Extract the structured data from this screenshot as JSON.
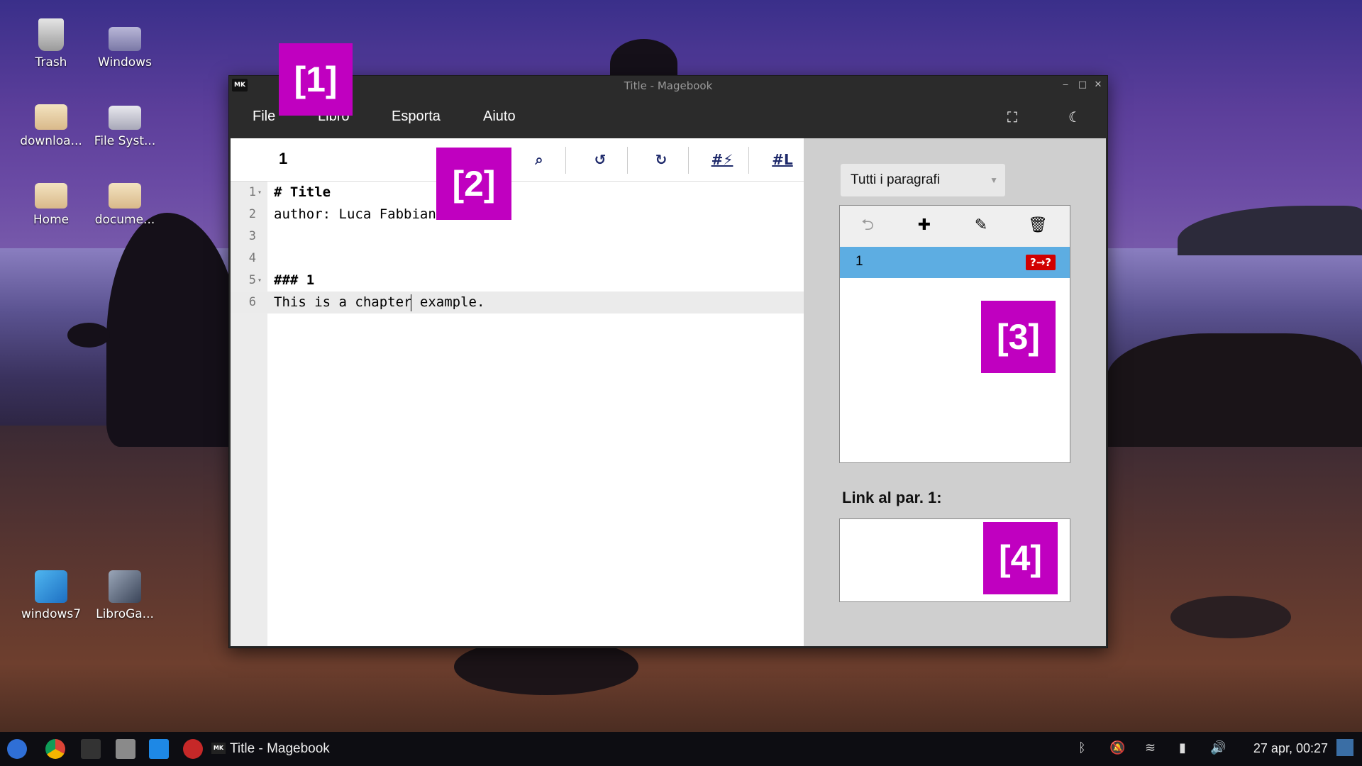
{
  "desktop": {
    "icons": [
      {
        "label": "Trash"
      },
      {
        "label": "Windows"
      },
      {
        "label": "downloa..."
      },
      {
        "label": "File Syst..."
      },
      {
        "label": "Home"
      },
      {
        "label": "docume..."
      },
      {
        "label": "windows7"
      },
      {
        "label": "LibroGa..."
      }
    ]
  },
  "window": {
    "title": "Title - Magebook",
    "logo": "MK",
    "controls": {
      "minimize": "‒",
      "maximize": "□",
      "close": "✕"
    },
    "menu": {
      "items": [
        "File",
        "Libro",
        "Esporta",
        "Aiuto"
      ],
      "icons": {
        "fullscreen": "fullscreen-icon",
        "theme": "moon-icon"
      }
    }
  },
  "editor": {
    "paragraph_number": "1",
    "toolbar": {
      "search": "search-icon",
      "undo": "undo-icon",
      "redo": "redo-icon",
      "tag_lightning": "#⚡",
      "tag_link": "#L"
    },
    "lines": [
      {
        "num": "1",
        "text": "# Title",
        "bold": true,
        "fold": true
      },
      {
        "num": "2",
        "text": "author: Luca Fabbian",
        "bold": false,
        "fold": false
      },
      {
        "num": "3",
        "text": "",
        "bold": false,
        "fold": false
      },
      {
        "num": "4",
        "text": "",
        "bold": false,
        "fold": false
      },
      {
        "num": "5",
        "text": "### 1",
        "bold": true,
        "fold": true
      },
      {
        "num": "6",
        "text": "This is a chapter example.",
        "bold": false,
        "fold": false,
        "active": true
      }
    ]
  },
  "sidebar": {
    "filter": {
      "selected": "Tutti i paragrafi"
    },
    "list_tools": [
      "back-icon",
      "plus-icon",
      "pencil-icon",
      "trash-icon"
    ],
    "paragraphs": [
      {
        "num": "1",
        "badge": "?→?"
      }
    ],
    "links_label": "Link al par. 1:"
  },
  "markers": [
    "[1]",
    "[2]",
    "[3]",
    "[4]"
  ],
  "taskbar": {
    "active_window": "Title - Magebook",
    "active_logo": "MK",
    "clock": "27 apr, 00:27"
  },
  "colors": {
    "selection": "#5dade2",
    "badge": "#d10000",
    "marker": "#c000c0",
    "toolbar_icons": "#1f2a6b"
  }
}
